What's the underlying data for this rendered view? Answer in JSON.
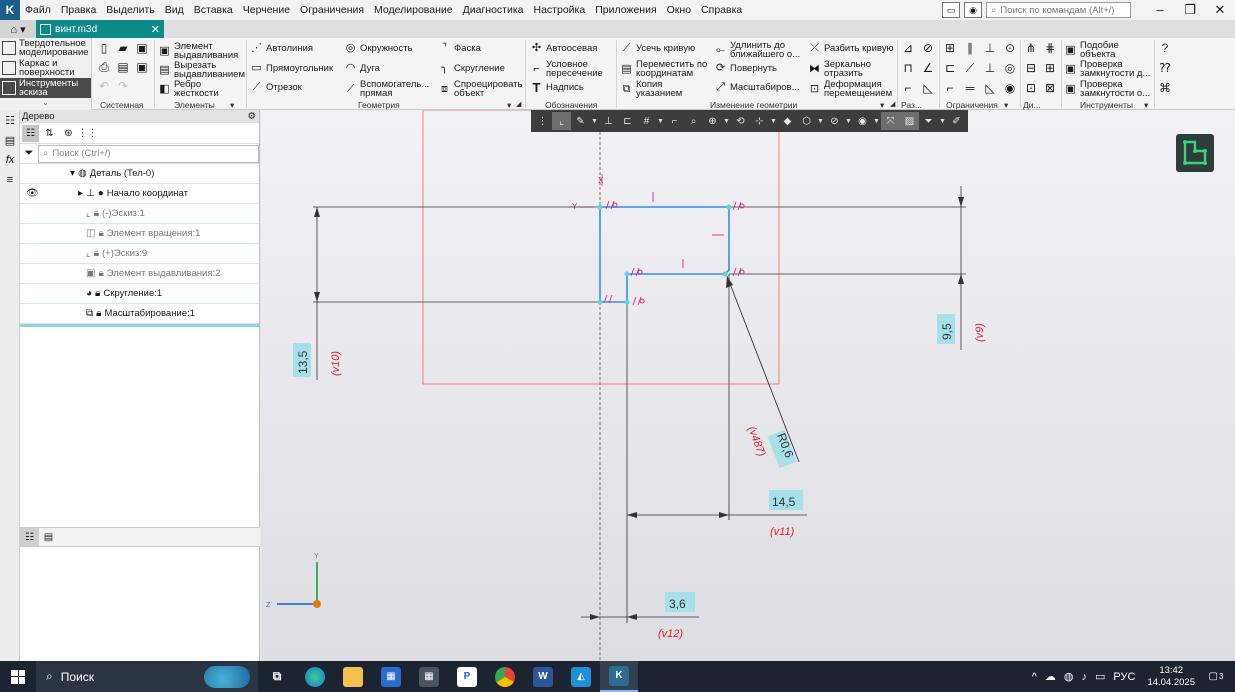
{
  "menu": {
    "items": [
      "Файл",
      "Правка",
      "Выделить",
      "Вид",
      "Вставка",
      "Черчение",
      "Ограничения",
      "Моделирование",
      "Диагностика",
      "Настройка",
      "Приложения",
      "Окно",
      "Справка"
    ],
    "search_placeholder": "Поиск по командам (Alt+/)"
  },
  "tab": {
    "title": "винт.m3d"
  },
  "modes": [
    "Твердотельное моделирование",
    "Каркас и поверхности",
    "Инструменты эскиза"
  ],
  "ribbon": {
    "groups": [
      "Системная",
      "Элементы",
      "Геометрия",
      "Обозначения",
      "Изменение геометрии",
      "Раз...",
      "Ограничения",
      "Ди...",
      "Инструменты"
    ],
    "elements": [
      "Элемент выдавливания",
      "Вырезать выдавливанием",
      "Ребро жесткости"
    ],
    "geometry": [
      "Автолиния",
      "Прямоугольник",
      "Отрезок",
      "Окружность",
      "Дуга",
      "Вспомогатель... прямая",
      "Фаска",
      "Скругление",
      "Спроецировать объект"
    ],
    "annotations": [
      "Автоосевая",
      "Условное пересечение",
      "Надпись"
    ],
    "modify": [
      "Усечь кривую",
      "Переместить по координатам",
      "Копия указанием",
      "Удлинить до ближайшего о...",
      "Повернуть",
      "Масштабиров...",
      "Разбить кривую",
      "Зеркально отразить",
      "Деформация перемещением"
    ],
    "tools": [
      "Подобие объекта",
      "Проверка замкнутости д...",
      "Проверка замкнутости о..."
    ]
  },
  "tree": {
    "header": "Дерево",
    "search_placeholder": "Поиск (Ctrl+/)",
    "rows": [
      {
        "label": "Деталь (Тел-0)",
        "icon": "part-icon"
      },
      {
        "label": "Начало координат",
        "icon": "origin-icon"
      },
      {
        "label": "(-)Эскиз:1",
        "icon": "sketch-icon"
      },
      {
        "label": "Элемент вращения:1",
        "icon": "revolve-icon"
      },
      {
        "label": "(+)Эскиз:9",
        "icon": "sketch-icon"
      },
      {
        "label": "Элемент выдавливания:2",
        "icon": "extrude-icon"
      },
      {
        "label": "Скругление:1",
        "icon": "fillet-icon"
      },
      {
        "label": "Масштабирование:1",
        "icon": "scale-icon"
      }
    ]
  },
  "drawing": {
    "dims": [
      {
        "value": "13,5",
        "var": "(v10)"
      },
      {
        "value": "9,5",
        "var": "(v9)"
      },
      {
        "value": "R0,6",
        "var": "(v487)"
      },
      {
        "value": "14,5",
        "var": "(v11)"
      },
      {
        "value": "3,6",
        "var": "(v12)"
      }
    ],
    "axis_x": "X",
    "axis_y": "Y",
    "axis_z": "Z"
  },
  "taskbar": {
    "search": "Поиск",
    "lang": "РУС",
    "time": "13:42",
    "date": "14.04.2025",
    "notifications": "3"
  },
  "colors": {
    "accent": "#0e8a8a",
    "sketch_blue": "#2f8ff0",
    "constraint_magenta": "#d0258a",
    "dim_red": "#e02020",
    "dim_box": "#a6e0ea"
  }
}
